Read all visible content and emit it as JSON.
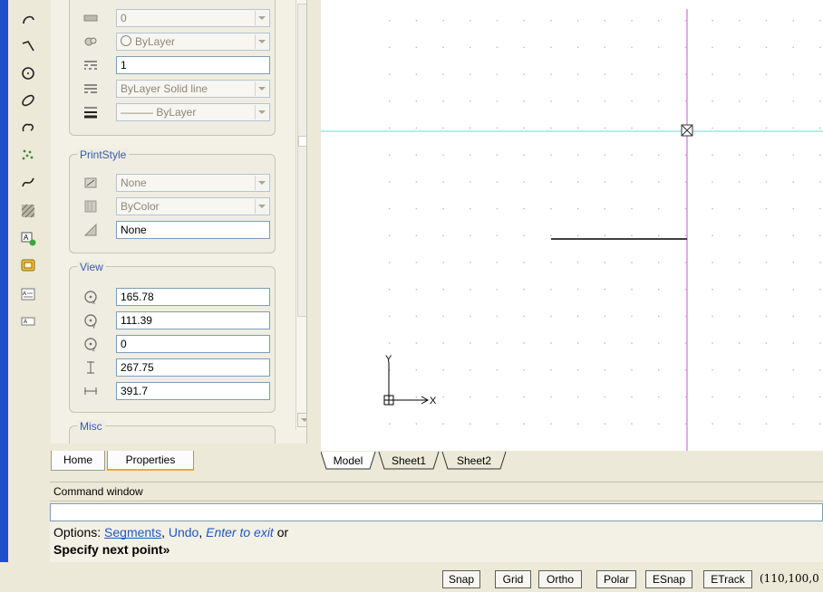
{
  "left_toolbar": {
    "tools": [
      "arc-icon",
      "polyline-icon",
      "circle-icon",
      "ellipse-icon",
      "revision-cloud-icon",
      "point-cloud-icon",
      "spline-icon",
      "hatch-icon",
      "insert-block-icon",
      "region-icon",
      "multiline-text-icon",
      "text-icon"
    ]
  },
  "properties": {
    "general_rows": [
      {
        "icon": "plot-style-icon",
        "value": "0",
        "dropdown": true,
        "disabled": true
      },
      {
        "icon": "color-icon",
        "value": "ByLayer",
        "dropdown": true,
        "disabled": true,
        "radio": true
      },
      {
        "icon": "linetype-scale-icon",
        "value": "1",
        "dropdown": false,
        "disabled": false
      },
      {
        "icon": "linetype-icon",
        "value": "ByLayer    Solid line",
        "dropdown": true,
        "disabled": true
      },
      {
        "icon": "lineweight-icon",
        "value": "——— ByLayer",
        "dropdown": true,
        "disabled": true
      }
    ],
    "printstyle": {
      "title": "PrintStyle",
      "rows": [
        {
          "icon": "print-style-icon",
          "value": "None",
          "dropdown": true,
          "disabled": true
        },
        {
          "icon": "print-table-icon",
          "value": "ByColor",
          "dropdown": true,
          "disabled": true
        },
        {
          "icon": "print-type-icon",
          "value": "None",
          "dropdown": false,
          "disabled": false
        }
      ]
    },
    "view": {
      "title": "View",
      "rows": [
        {
          "icon": "center-x-icon",
          "value": "165.78"
        },
        {
          "icon": "center-y-icon",
          "value": "111.39"
        },
        {
          "icon": "center-z-icon",
          "value": "0"
        },
        {
          "icon": "height-icon",
          "value": "267.75"
        },
        {
          "icon": "width-icon",
          "value": "391.7"
        }
      ]
    },
    "misc_title": "Misc",
    "tabs": {
      "home": "Home",
      "properties": "Properties"
    }
  },
  "model_tabs": {
    "model": "Model",
    "sheet1": "Sheet1",
    "sheet2": "Sheet2"
  },
  "ucs": {
    "x": "X",
    "y": "Y"
  },
  "colors": {
    "cursor_h": "#6fd8ee",
    "cursor_v": "#d94bd9",
    "grid_dot": "#b9b9b9"
  },
  "command": {
    "title": "Command window",
    "options_label": "Options:",
    "opt_segments": "Segments",
    "opt_undo": "Undo",
    "opt_enter": "Enter to exit",
    "or_word": "or",
    "prompt": "Specify next point»"
  },
  "status": {
    "snap": "Snap",
    "grid": "Grid",
    "ortho": "Ortho",
    "polar": "Polar",
    "esnap": "ESnap",
    "etrack": "ETrack",
    "coords": "(110,100,0"
  }
}
